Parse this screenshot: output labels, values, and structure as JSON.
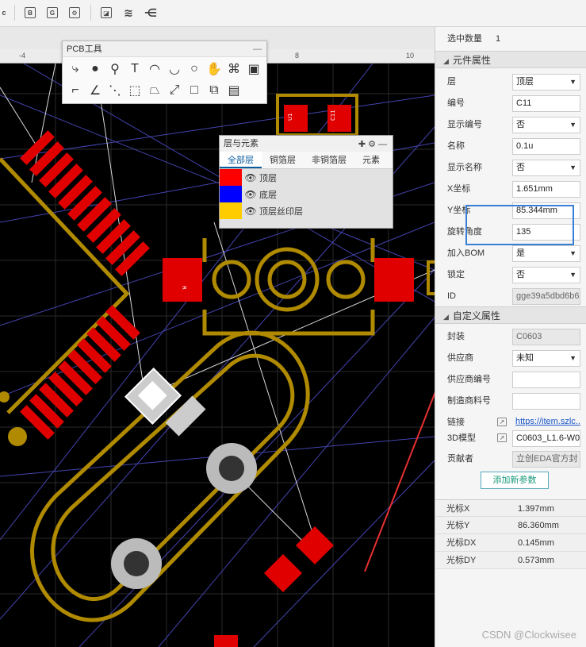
{
  "toolbar": {
    "icons": [
      "c",
      "B",
      "G",
      "gear-square",
      "image",
      "layers-icon",
      "share-icon"
    ],
    "label_c": "c",
    "label_b": "B",
    "label_g": "G"
  },
  "ruler": {
    "ticks": [
      "-4",
      "8",
      "10"
    ]
  },
  "pcb_tools": {
    "title": "PCB工具",
    "minimize": "—"
  },
  "layers_panel": {
    "title": "层与元素",
    "tabs": [
      "全部层",
      "铜箔层",
      "非铜箔层",
      "元素"
    ],
    "active_tab": 0,
    "layers": [
      {
        "name": "顶层",
        "color": "#ff0000"
      },
      {
        "name": "底层",
        "color": "#0000ff"
      },
      {
        "name": "顶层丝印层",
        "color": "#ffcc00"
      }
    ]
  },
  "properties": {
    "selected_count_label": "选中数量",
    "selected_count": "1",
    "component_section": "元件属性",
    "fields": [
      {
        "label": "层",
        "value": "顶层",
        "dropdown": true
      },
      {
        "label": "编号",
        "value": "C11",
        "dropdown": false
      },
      {
        "label": "显示编号",
        "value": "否",
        "dropdown": true
      },
      {
        "label": "名称",
        "value": "0.1u",
        "dropdown": false
      },
      {
        "label": "显示名称",
        "value": "否",
        "dropdown": true
      },
      {
        "label": "X坐标",
        "value": "1.651mm",
        "dropdown": false
      },
      {
        "label": "Y坐标",
        "value": "85.344mm",
        "dropdown": false
      },
      {
        "label": "旋转角度",
        "value": "135",
        "dropdown": false
      },
      {
        "label": "加入BOM",
        "value": "是",
        "dropdown": true
      },
      {
        "label": "锁定",
        "value": "否",
        "dropdown": true
      },
      {
        "label": "ID",
        "value": "gge39a5dbd6b6",
        "dropdown": false,
        "disabled": true
      }
    ],
    "custom_section": "自定义属性",
    "custom_fields": [
      {
        "label": "封装",
        "value": "C0603",
        "dropdown": false,
        "disabled": true
      },
      {
        "label": "供应商",
        "value": "未知",
        "dropdown": true
      },
      {
        "label": "供应商编号",
        "value": "",
        "dropdown": false
      },
      {
        "label": "制造商料号",
        "value": "",
        "dropdown": false
      },
      {
        "label": "链接",
        "value": "https://item.szlc...",
        "link": true
      },
      {
        "label": "3D模型",
        "value": "C0603_L1.6-W0",
        "ext": true
      },
      {
        "label": "贡献者",
        "value": "立创EDA官方封",
        "disabled": true
      }
    ],
    "add_param": "添加新参数"
  },
  "cursor": [
    {
      "label": "光标X",
      "value": "1.397mm"
    },
    {
      "label": "光标Y",
      "value": "86.360mm"
    },
    {
      "label": "光标DX",
      "value": "0.145mm"
    },
    {
      "label": "光标DY",
      "value": "0.573mm"
    }
  ],
  "watermark": "CSDN @Clockwisee",
  "pcb_labels": {
    "u1": "U1",
    "c11": "C11",
    "r": "R"
  },
  "colors": {
    "copper_top": "#e00000",
    "silkscreen": "#c8a000",
    "trace": "#6666ff",
    "highlight": "#3a7fd6",
    "arrow": "#e83030"
  }
}
